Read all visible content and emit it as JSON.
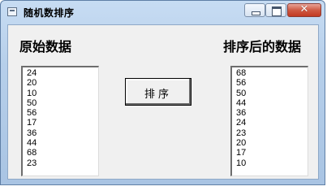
{
  "window": {
    "title": "随机数排序",
    "minimize_glyph": "",
    "maximize_glyph": "",
    "close_glyph": "✕",
    "icon": "app-window-icon",
    "colors": {
      "title_gradient_top": "#c7dcf3",
      "client_bg": "#f0f0f0",
      "close_red": "#c23a22"
    }
  },
  "labels": {
    "original": "原始数据",
    "sorted": "排序后的数据"
  },
  "button": {
    "sort_label": "排序"
  },
  "lists": {
    "original": [
      "24",
      "20",
      "10",
      "50",
      "56",
      "17",
      "36",
      "44",
      "68",
      "23"
    ],
    "sorted": [
      "68",
      "56",
      "50",
      "44",
      "36",
      "24",
      "23",
      "20",
      "17",
      "10"
    ]
  }
}
